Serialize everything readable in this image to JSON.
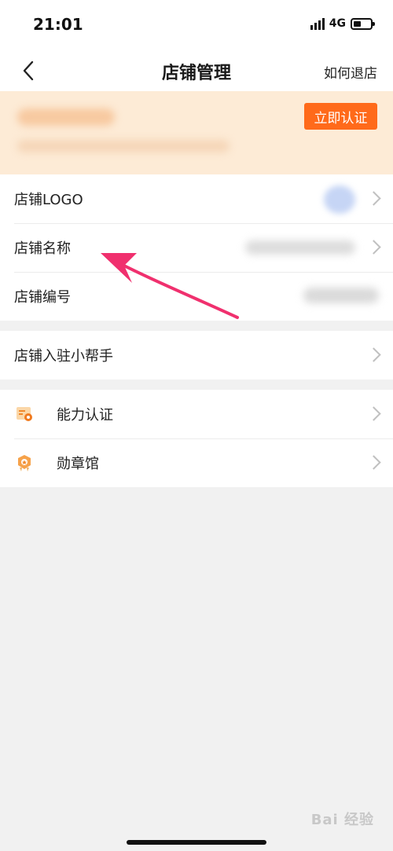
{
  "status_bar": {
    "time": "21:01",
    "network": "4G",
    "battery_level": 0.45
  },
  "nav": {
    "title": "店铺管理",
    "right_link": "如何退店",
    "back_icon": "chevron-left-icon"
  },
  "banner": {
    "button_label": "立即认证",
    "background_color": "#fdebd6",
    "accent_color": "#ff6a1a"
  },
  "store_info": {
    "items": [
      {
        "label": "店铺LOGO"
      },
      {
        "label": "店铺名称"
      },
      {
        "label": "店铺编号"
      }
    ]
  },
  "helper": {
    "label": "店铺入驻小帮手"
  },
  "features": {
    "items": [
      {
        "label": "能力认证",
        "icon": "certificate-icon"
      },
      {
        "label": "勋章馆",
        "icon": "medal-icon"
      }
    ]
  },
  "annotation": {
    "color": "#f0306e"
  },
  "watermark": {
    "text": "Bai 经验"
  }
}
